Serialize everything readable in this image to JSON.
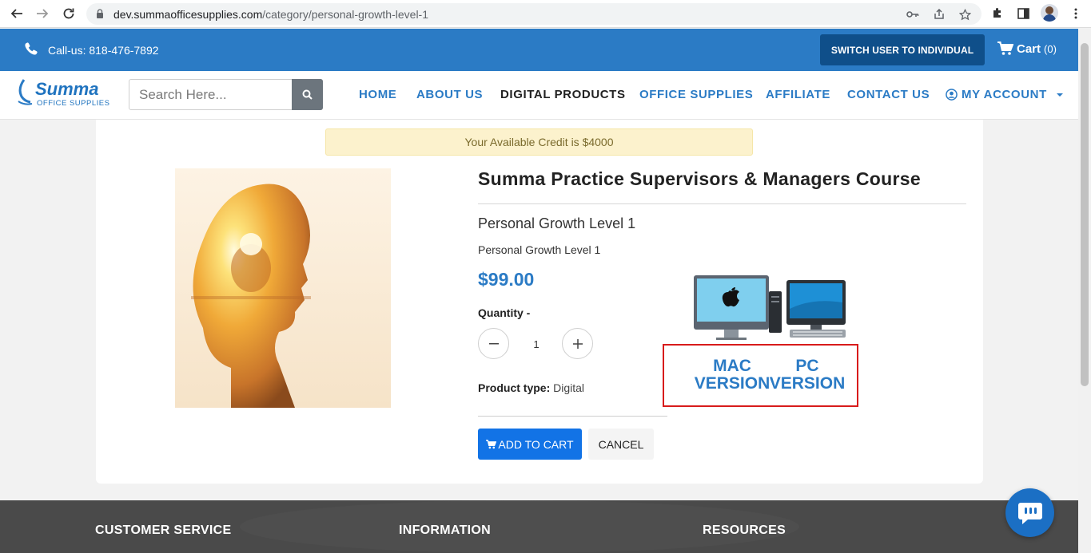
{
  "browser": {
    "url_host": "dev.summaofficesupplies.com",
    "url_path": "/category/personal-growth-level-1"
  },
  "topbar": {
    "phone": "Call-us: 818-476-7892",
    "switch_label": "SWITCH USER TO INDIVIDUAL",
    "cart_label": "Cart",
    "cart_count": "(0)"
  },
  "header": {
    "logo_text": "Summa",
    "logo_sub": "OFFICE SUPPLIES",
    "search_placeholder": "Search Here...",
    "menu": [
      "HOME",
      "ABOUT US",
      "DIGITAL PRODUCTS",
      "OFFICE SUPPLIES",
      "AFFILIATE",
      "CONTACT US",
      "MY ACCOUNT"
    ]
  },
  "product": {
    "credit": "Your Available Credit is $4000",
    "title": "Summa Practice Supervisors & Managers Course",
    "subtitle": "Personal Growth Level 1",
    "description": "Personal Growth Level 1",
    "price": "$99.00",
    "quantity_label": "Quantity -",
    "quantity": "1",
    "product_type_label": "Product type:",
    "product_type": "Digital",
    "add_to_cart": "ADD TO CART",
    "cancel": "CANCEL",
    "mac_version": "MAC VERSION",
    "pc_version": "PC VERSION"
  },
  "footer": {
    "headings": [
      "CUSTOMER SERVICE",
      "INFORMATION",
      "RESOURCES"
    ]
  },
  "colors": {
    "brand_blue": "#2b7bc5",
    "dark_blue": "#0f4f8a",
    "button_blue": "#1273e6",
    "highlight_red": "#d81b1b"
  }
}
